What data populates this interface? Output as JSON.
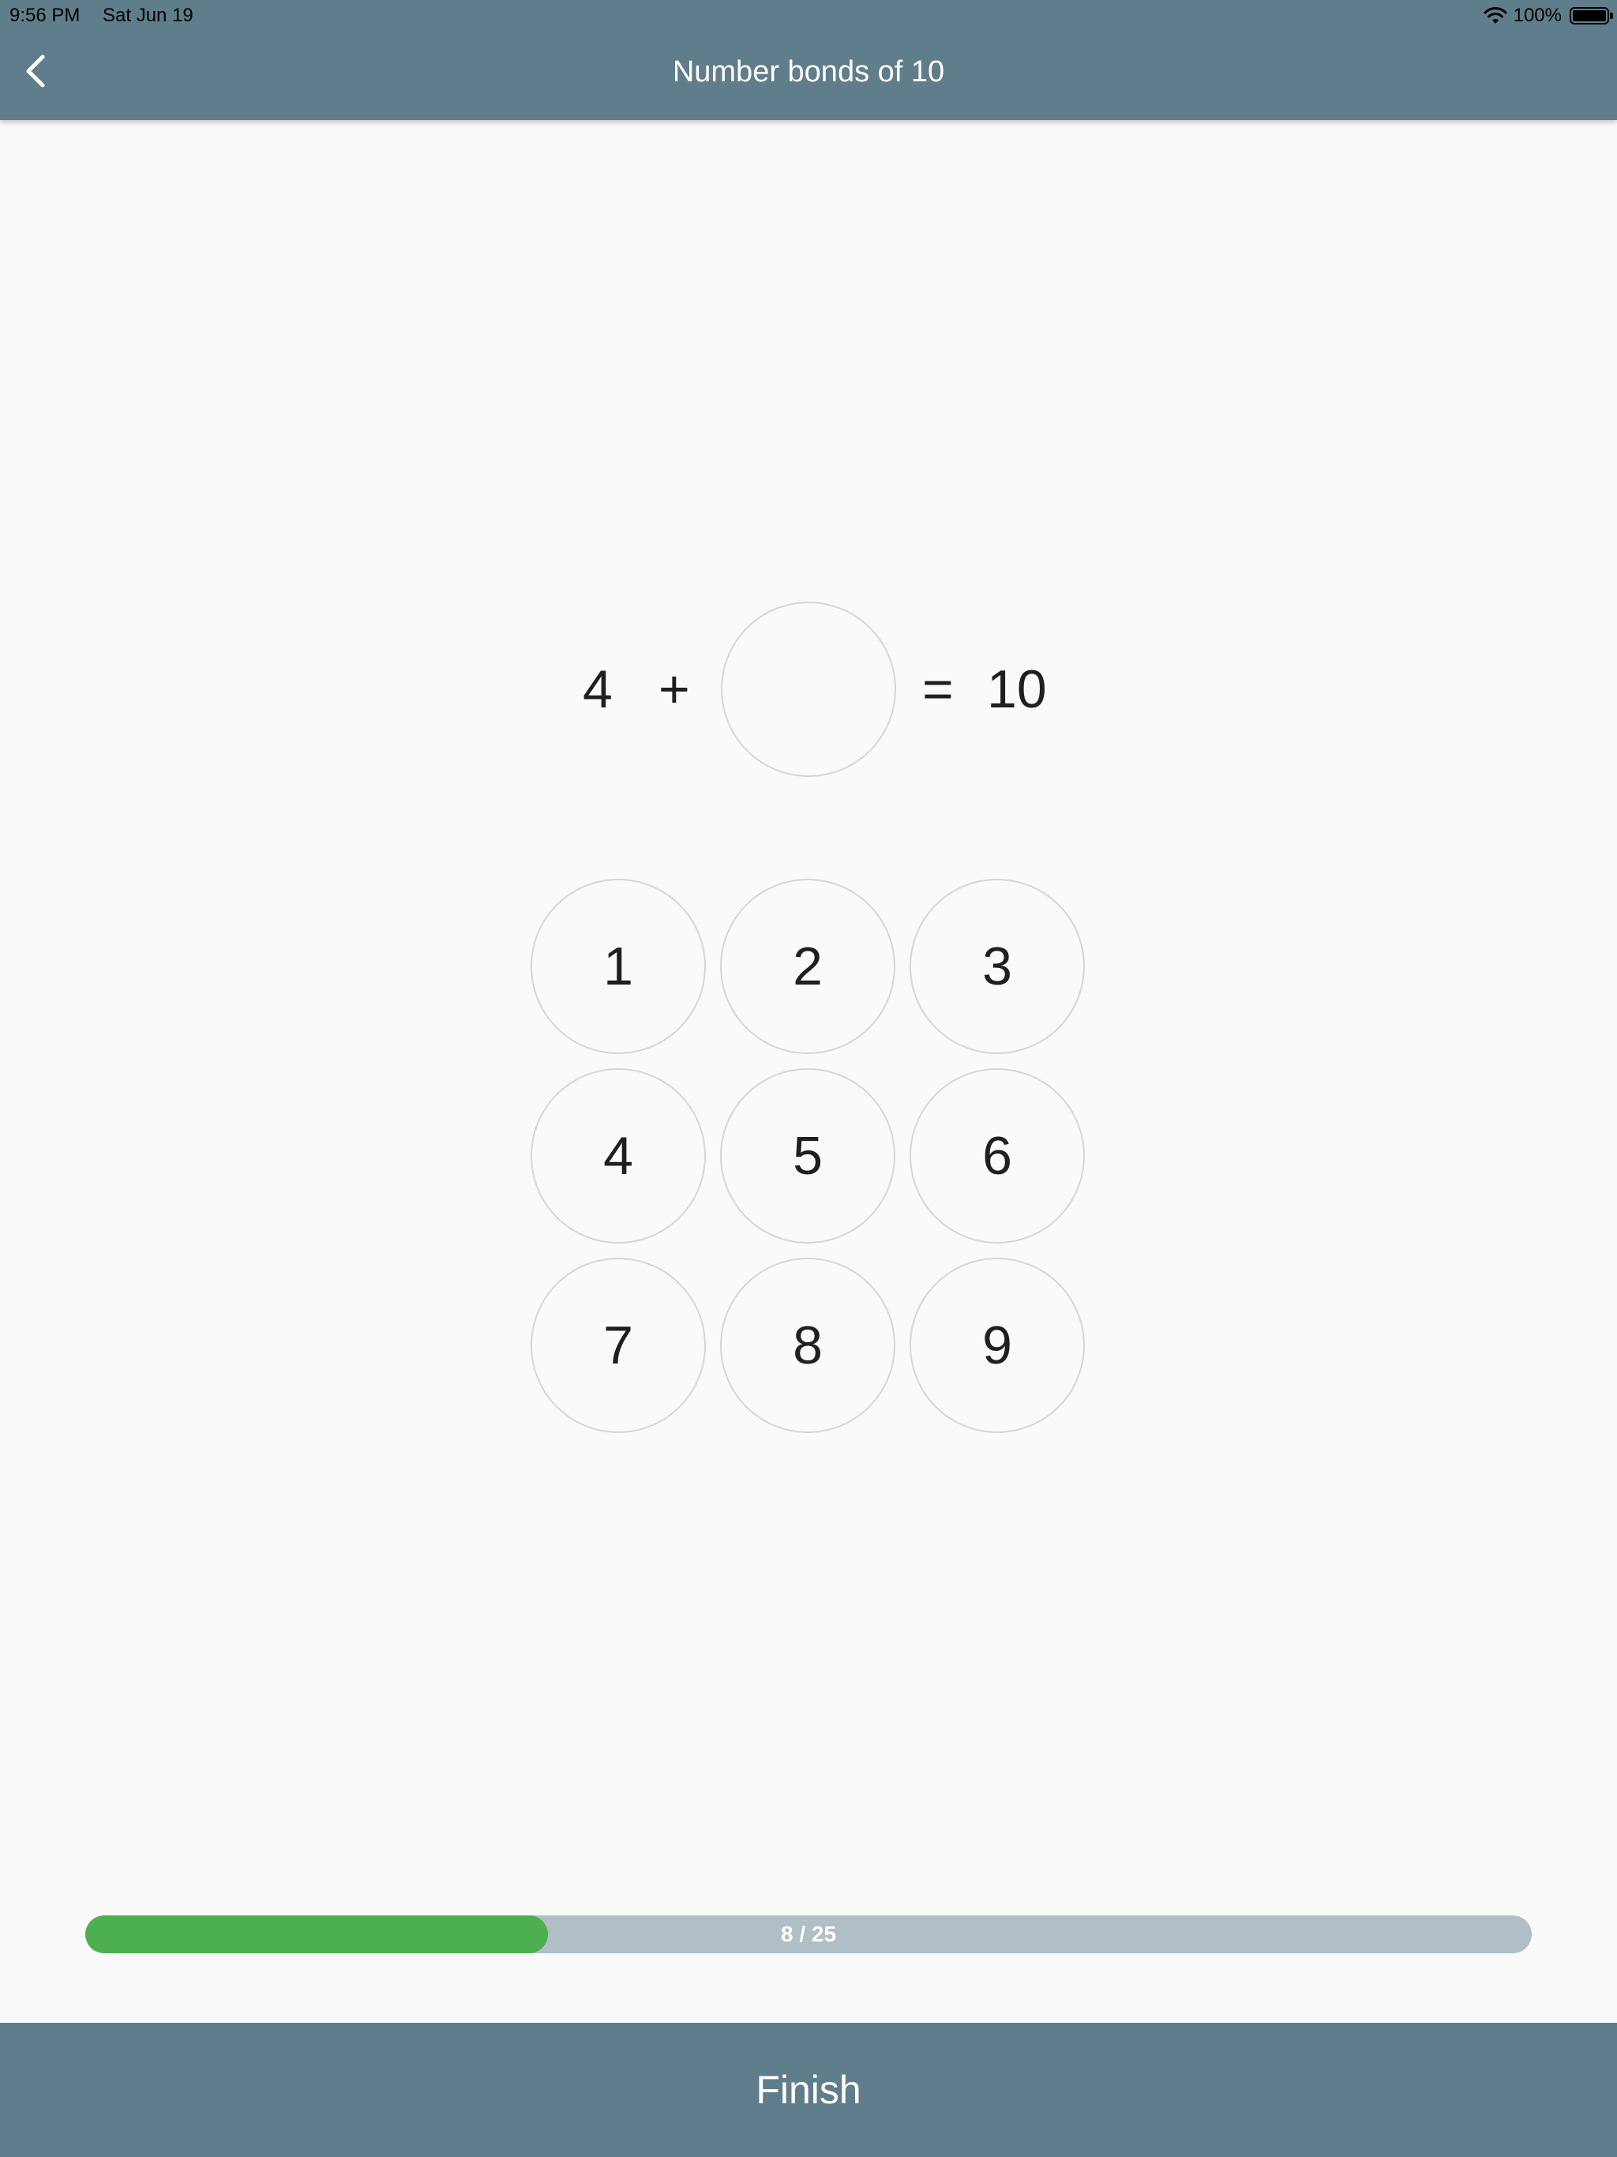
{
  "status_bar": {
    "time": "9:56 PM",
    "date": "Sat Jun 19",
    "battery_percent": "100%"
  },
  "header": {
    "title": "Number bonds of 10",
    "back_icon": "chevron-left-icon"
  },
  "equation": {
    "operand": "4",
    "operator": "+",
    "answer": "",
    "equals": "=",
    "result": "10"
  },
  "keypad": {
    "keys": [
      "1",
      "2",
      "3",
      "4",
      "5",
      "6",
      "7",
      "8",
      "9"
    ]
  },
  "progress": {
    "label": "8 / 25",
    "current": 8,
    "total": 25,
    "fill_color": "#4caf50",
    "track_color": "#b0bec5"
  },
  "footer": {
    "finish_label": "Finish"
  },
  "colors": {
    "app_bar": "#607d8b",
    "background": "#fafafa"
  }
}
